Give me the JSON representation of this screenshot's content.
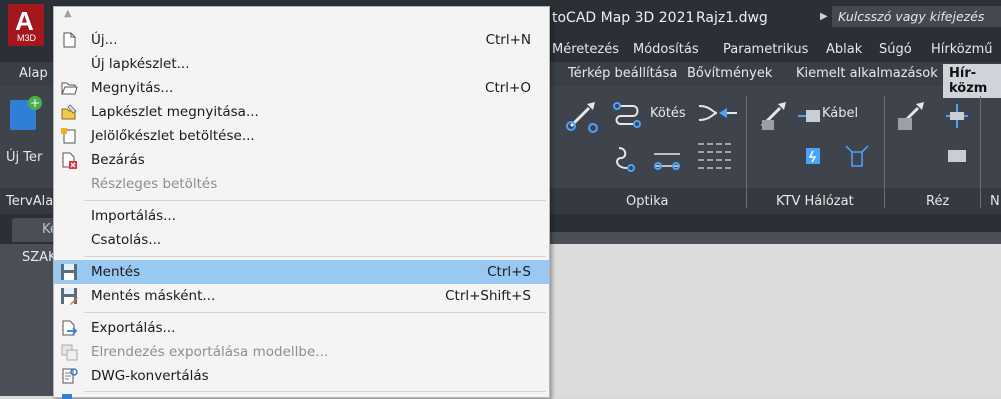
{
  "app": {
    "logo_letter": "A",
    "logo_sub": "M3D",
    "title": "toCAD Map 3D 2021",
    "filename": "Rajz1.dwg",
    "search_placeholder": "Kulcsszó vagy kifejezés"
  },
  "menubar": {
    "items": [
      "Méretezés",
      "Módosítás",
      "Parametrikus",
      "Ablak",
      "Súgó",
      "Hírközmű"
    ]
  },
  "ribbon_tabs": {
    "left": "Alap",
    "items": [
      "Térkép beállítása",
      "Bővítmények",
      "Kiemelt alkalmazások"
    ],
    "active": "Hír-közm"
  },
  "ribbon": {
    "left_button": "Új Ter",
    "kotes": "Kötés",
    "kabel": "Kábel",
    "panel_left": "TervAla",
    "panels": [
      "Optika",
      "KTV Hálózat",
      "Réz",
      "N"
    ]
  },
  "doc": {
    "tab": "Ke",
    "side_label": "SZAK"
  },
  "menu": {
    "items": [
      {
        "label": "Új...",
        "shortcut": "Ctrl+N"
      },
      {
        "label": "Új lapkészlet..."
      },
      {
        "label": "Megnyitás...",
        "shortcut": "Ctrl+O"
      },
      {
        "label": "Lapkészlet megnyitása..."
      },
      {
        "label": "Jelölőkészlet betöltése..."
      },
      {
        "label": "Bezárás"
      },
      {
        "label": "Részleges betöltés"
      },
      {
        "label": "Importálás..."
      },
      {
        "label": "Csatolás..."
      },
      {
        "label": "Mentés",
        "shortcut": "Ctrl+S"
      },
      {
        "label": "Mentés másként...",
        "shortcut": "Ctrl+Shift+S"
      },
      {
        "label": "Exportálás..."
      },
      {
        "label": "Elrendezés exportálása modellbe..."
      },
      {
        "label": "DWG-konvertálás"
      }
    ]
  },
  "colors": {
    "highlight": "#99c9f2",
    "app_dark": "#2b2f36",
    "logo_red": "#a3171d",
    "accent_blue": "#2f7fd6"
  }
}
